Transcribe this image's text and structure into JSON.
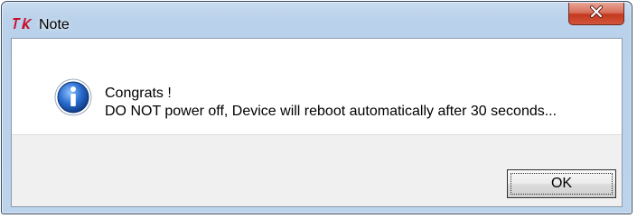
{
  "window": {
    "title": "Note",
    "app_icon": "tk-feather-icon",
    "close_icon": "close-icon",
    "close_symbol": "✕"
  },
  "message": {
    "icon": "info-icon",
    "line1": "Congrats !",
    "line2": "DO NOT power off, Device will reboot automatically after 30 seconds..."
  },
  "buttons": {
    "ok_label": "OK"
  },
  "colors": {
    "close_button": "#c4391f",
    "info_icon": "#1f5fb8",
    "app_icon": "#c8102e"
  }
}
